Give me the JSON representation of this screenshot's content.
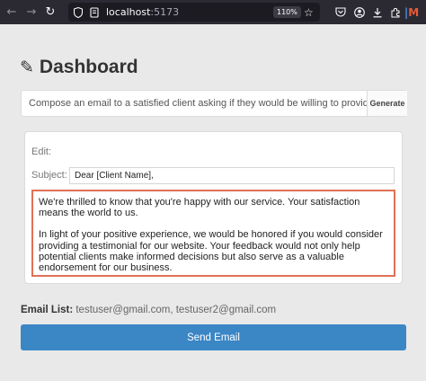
{
  "browser": {
    "url_host": "localhost",
    "url_port": ":5173",
    "zoom": "110%",
    "extension_badge": "M"
  },
  "page": {
    "title": "Dashboard",
    "prompt_value": "Compose an email to a satisfied client asking if they would be willing to provide a te",
    "generate_label": "Generate",
    "edit_label": "Edit:",
    "subject_label": "Subject:",
    "subject_value": "Dear [Client Name],",
    "body_paragraph_1": "We're thrilled to know that you're happy with our service. Your satisfaction means the world to us.",
    "body_paragraph_2": "In light of your positive experience, we would be honored if you would consider providing a testimonial for our website. Your feedback would not only help potential clients make informed decisions but also serve as a valuable endorsement for our business.",
    "email_list_label": "Email List:",
    "email_list_value": "testuser@gmail.com, testuser2@gmail.com",
    "send_label": "Send Email"
  },
  "colors": {
    "browser_toolbar": "#2b2a33",
    "send_button": "#3b86c5",
    "body_border": "#e07055"
  }
}
